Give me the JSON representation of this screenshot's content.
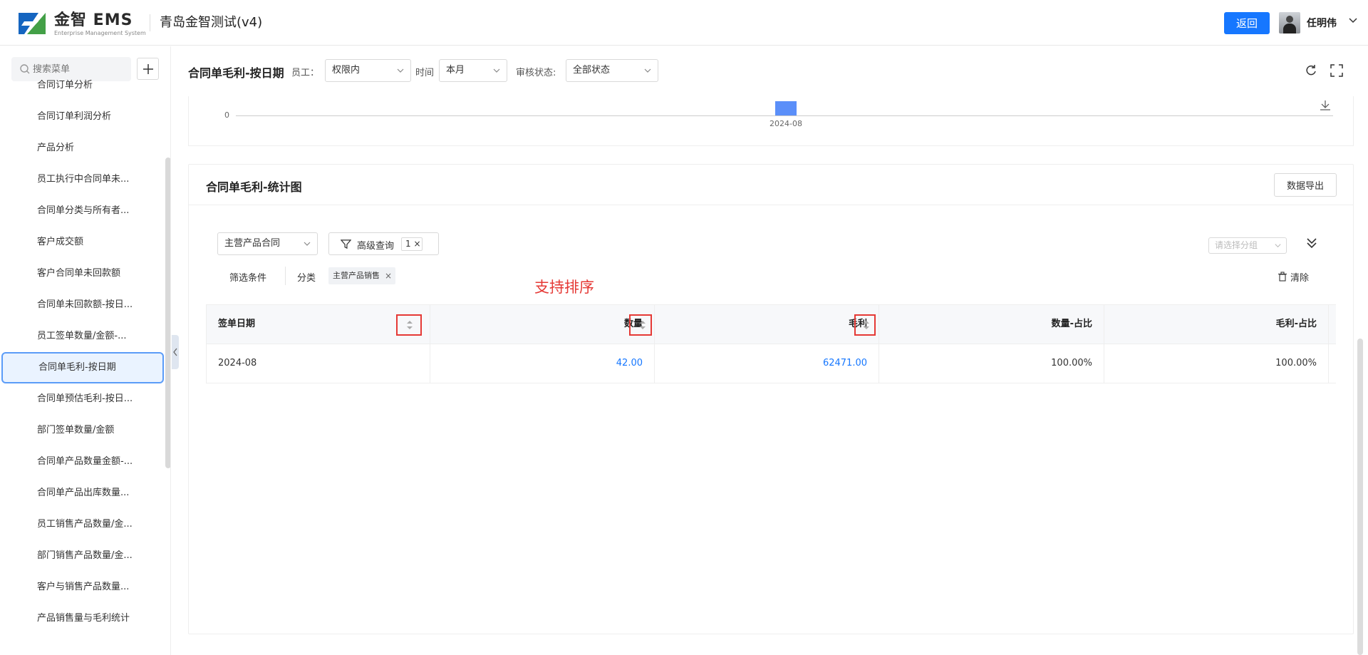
{
  "header": {
    "logo_title": "金智 EMS",
    "logo_subtitle": "Enterprise Management System",
    "company": "青岛金智测试(v4)",
    "back_label": "返回",
    "user_name": "任明伟"
  },
  "sidebar": {
    "search_placeholder": "搜索菜单",
    "items": [
      {
        "label": "合同订单分析"
      },
      {
        "label": "合同订单利润分析"
      },
      {
        "label": "产品分析"
      },
      {
        "label": "员工执行中合同单未..."
      },
      {
        "label": "合同单分类与所有者..."
      },
      {
        "label": "客户成交额"
      },
      {
        "label": "客户合同单未回款额"
      },
      {
        "label": "合同单未回款额-按日..."
      },
      {
        "label": "员工签单数量/金额-..."
      },
      {
        "label": "合同单毛利-按日期",
        "active": true
      },
      {
        "label": "合同单预估毛利-按日..."
      },
      {
        "label": "部门签单数量/金额"
      },
      {
        "label": "合同单产品数量金额-..."
      },
      {
        "label": "合同单产品出库数量..."
      },
      {
        "label": "员工销售产品数量/金..."
      },
      {
        "label": "部门销售产品数量/金..."
      },
      {
        "label": "客户与销售产品数量..."
      },
      {
        "label": "产品销售量与毛利统计"
      }
    ]
  },
  "toolbar": {
    "title": "合同单毛利-按日期",
    "employee_label": "员工：",
    "employee_value": "权限内",
    "time_label": "时间",
    "time_value": "本月",
    "status_label": "审核状态:",
    "status_value": "全部状态"
  },
  "chart_data": {
    "type": "bar",
    "categories": [
      "2024-08"
    ],
    "values": [
      62471.0
    ],
    "ytick_visible": "0",
    "xtick": "2024-08"
  },
  "stats": {
    "title": "合同单毛利-统计图",
    "export_label": "数据导出",
    "contract_type": "主营产品合同",
    "adv_query_label": "高级查询",
    "adv_query_count": "1",
    "group_placeholder": "请选择分组",
    "condition_label": "筛选条件",
    "category_label": "分类",
    "tag_label": "主营产品销售",
    "clear_label": "清除",
    "annotation": "支持排序"
  },
  "table": {
    "columns": [
      "签单日期",
      "数量",
      "毛利",
      "数量-占比",
      "毛利-占比"
    ],
    "rows": [
      [
        "2024-08",
        "42.00",
        "62471.00",
        "100.00%",
        "100.00%"
      ]
    ]
  }
}
